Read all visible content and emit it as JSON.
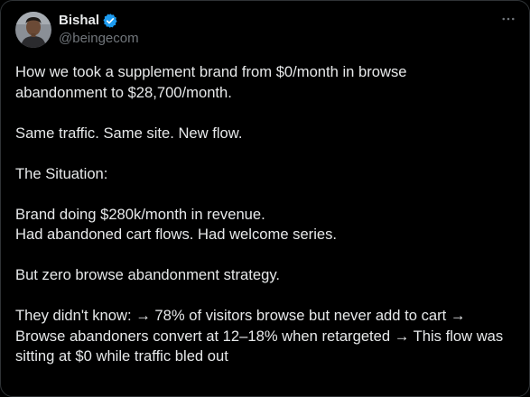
{
  "author": {
    "display_name": "Bishal",
    "handle": "@beingecom",
    "verified": true,
    "avatar_icon": "profile-photo"
  },
  "menu": {
    "icon": "more-horizontal-icon"
  },
  "colors": {
    "background": "#000000",
    "text": "#e7e9ea",
    "secondary_text": "#71767b",
    "verified_badge": "#1d9bf0",
    "border": "#2f3336"
  },
  "post": {
    "p1": {
      "l1": "How we took a supplement brand from $0/month in browse",
      "l2": "abandonment to $28,700/month."
    },
    "p2": "Same traffic. Same site. New flow.",
    "p3": "The Situation:",
    "p4": {
      "l1": "Brand doing $280k/month in revenue.",
      "l2": "Had abandoned cart flows. Had welcome series."
    },
    "p5": "But zero browse abandonment strategy.",
    "p6": {
      "l1": "They didn't know: → 78% of visitors browse but never add to cart →",
      "l2": "Browse abandoners convert at 12–18% when retargeted → This flow was",
      "l3": "sitting at $0 while traffic bled out"
    }
  }
}
